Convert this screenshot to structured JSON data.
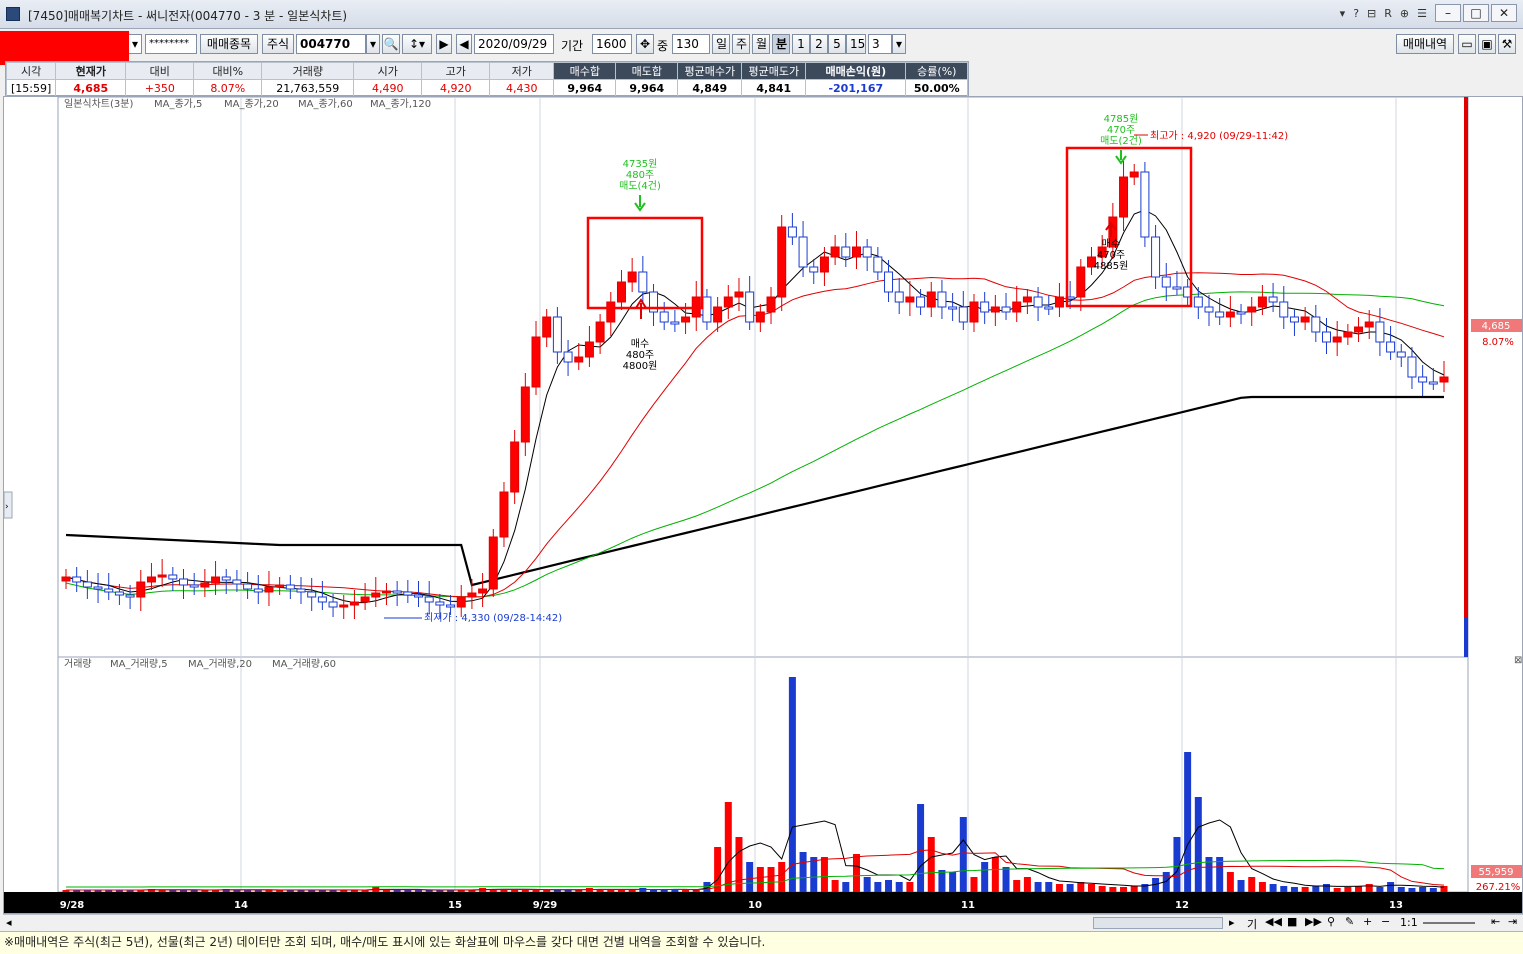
{
  "window": {
    "title": "[7450]매매복기차트 - 써니전자(004770 - 3 분 - 일본식차트)",
    "toolbar_icons": [
      "pin-icon",
      "help-icon",
      "screen-icon",
      "r-icon",
      "link-icon",
      "menu-icon"
    ]
  },
  "toolbar": {
    "account_mask": "********",
    "trade_items_label": "매매종목",
    "market": "주식",
    "code": "004770",
    "date": "2020/09/29",
    "period_label": "기간",
    "period_value": "1600",
    "count_label": "중",
    "count_value": "130",
    "periods": [
      "일",
      "주",
      "월",
      "분",
      "1",
      "2",
      "5",
      "15"
    ],
    "minute_value": "3",
    "trade_history_label": "매매내역"
  },
  "quote": {
    "headers": [
      "시각",
      "현재가",
      "대비",
      "대비%",
      "거래량",
      "시가",
      "고가",
      "저가",
      "매수합",
      "매도합",
      "평균매수가",
      "평균매도가",
      "매매손익(원)",
      "승률(%)"
    ],
    "values": [
      "[15:59]",
      "4,685",
      "+350",
      "8.07%",
      "21,763,559",
      "4,490",
      "4,920",
      "4,430",
      "9,964",
      "9,964",
      "4,849",
      "4,841",
      "-201,167",
      "50.00%"
    ]
  },
  "price_panel": {
    "legend_title": "일본식차트(3분)",
    "legend_items": [
      "MA_종가,5",
      "MA_종가,20",
      "MA_종가,60",
      "MA_종가,120"
    ],
    "legend_colors": [
      "#e00000",
      "#000000",
      "#e00000",
      "#00b000"
    ],
    "current_price_label": "4,685",
    "current_rate_label": "8.07%",
    "high_label": "최고가 : 4,920 (09/29-11:42)",
    "low_label": "최저가 : 4,330 (09/28-14:42)",
    "sell1": [
      "4735원",
      "480주",
      "매도(4건)"
    ],
    "buy1": [
      "매수",
      "480주",
      "4800원"
    ],
    "sell2": [
      "4785원",
      "470주",
      "매도(2건)"
    ],
    "buy2": [
      "매수",
      "470주",
      "4885원"
    ]
  },
  "volume_panel": {
    "legend_title": "거래량",
    "legend_items": [
      "MA_거래량,5",
      "MA_거래량,20",
      "MA_거래량,60"
    ],
    "legend_colors": [
      "#e00000",
      "#000000",
      "#e00000",
      "#00b000"
    ],
    "last_volume_label": "55,959",
    "last_rate_label": "267.21%"
  },
  "x_axis": {
    "labels": [
      "9/28",
      "14",
      "15",
      "9/29",
      "10",
      "11",
      "12",
      "13"
    ]
  },
  "scroll": {
    "zoom_label": "1:1",
    "mode_label": "기"
  },
  "status": {
    "message": "※매매내역은 주식(최근 5년), 선물(최근 2년) 데이터만 조회 되며, 매수/매도 표시에 있는 화살표에 마우스를 갖다 대면 건별 내역을 조회할 수 있습니다."
  },
  "chart_data": {
    "type": "candlestick",
    "x_labels": [
      "9/28",
      "14",
      "15",
      "9/29",
      "10",
      "11",
      "12",
      "13"
    ],
    "y_range": [
      4330,
      4920
    ],
    "price": {
      "open": 4490,
      "high": 4920,
      "low": 4430,
      "close": 4685,
      "change": "+350",
      "change_pct": "8.07%"
    },
    "markers": [
      {
        "type": "sell",
        "price": 4735,
        "qty": 480,
        "count": 4
      },
      {
        "type": "buy",
        "price": 4800,
        "qty": 480
      },
      {
        "type": "sell",
        "price": 4785,
        "qty": 470,
        "count": 2
      },
      {
        "type": "buy",
        "price": 4885,
        "qty": 470
      }
    ],
    "series": [
      {
        "name": "MA_종가,5"
      },
      {
        "name": "MA_종가,20"
      },
      {
        "name": "MA_종가,60"
      },
      {
        "name": "MA_종가,120"
      }
    ]
  }
}
